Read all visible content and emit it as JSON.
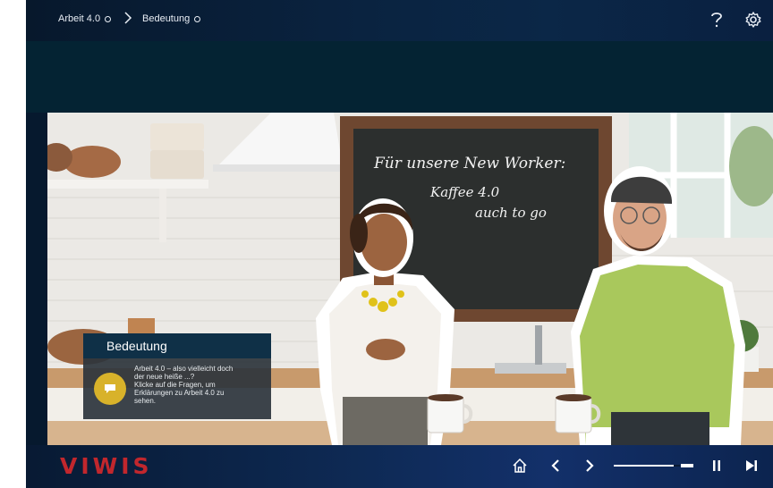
{
  "breadcrumb": {
    "item1": "Arbeit 4.0",
    "item2": "Bedeutung"
  },
  "header_icons": {
    "help": "question-mark-icon",
    "settings": "gear-icon"
  },
  "scene": {
    "chalkboard_line1": "Für unsere New Worker:",
    "chalkboard_line2": "Kaffee 4.0",
    "chalkboard_line3": "auch to go"
  },
  "info_panel": {
    "title": "Bedeutung",
    "text_line1": "Arbeit 4.0 – also vielleicht doch",
    "text_line2": "der neue heiße ...?",
    "text_line3": "Klicke auf die Fragen, um",
    "text_line4": "Erklärungen zu Arbeit 4.0 zu",
    "text_line5": "sehen.",
    "icon": "speech-bubble-icon"
  },
  "footer": {
    "logo": "VIWIS",
    "controls": [
      "home-icon",
      "previous-icon",
      "next-icon",
      "pause-icon",
      "skip-end-icon"
    ],
    "progress": 0.9
  },
  "colors": {
    "accent_yellow": "#d8b22a",
    "logo_red": "#c1272d",
    "header_navy": "#0a2340",
    "band": "#042333"
  }
}
